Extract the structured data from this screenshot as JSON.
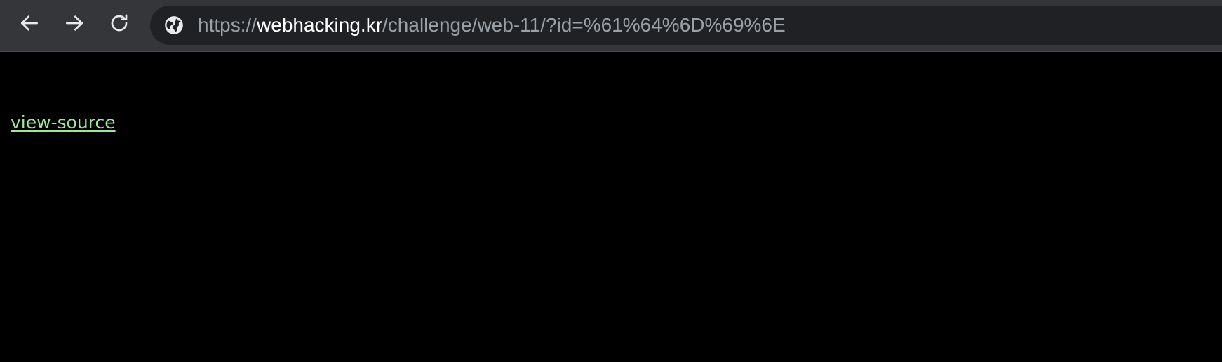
{
  "browser": {
    "icons": {
      "back": "arrow-left-icon",
      "forward": "arrow-right-icon",
      "reload": "reload-icon",
      "site_info": "globe-icon"
    },
    "address_bar": {
      "scheme": "https://",
      "host": "webhacking.kr",
      "path": "/challenge/web-11/?id=%61%64%6D%69%6E"
    },
    "colors": {
      "toolbar_bg": "#35363a",
      "omnibox_bg": "#202124",
      "url_dim": "#9aa0a6",
      "url_host": "#ffffff"
    }
  },
  "page": {
    "link_label": "view-source",
    "colors": {
      "background": "#000000",
      "link": "#9fe69a"
    }
  }
}
